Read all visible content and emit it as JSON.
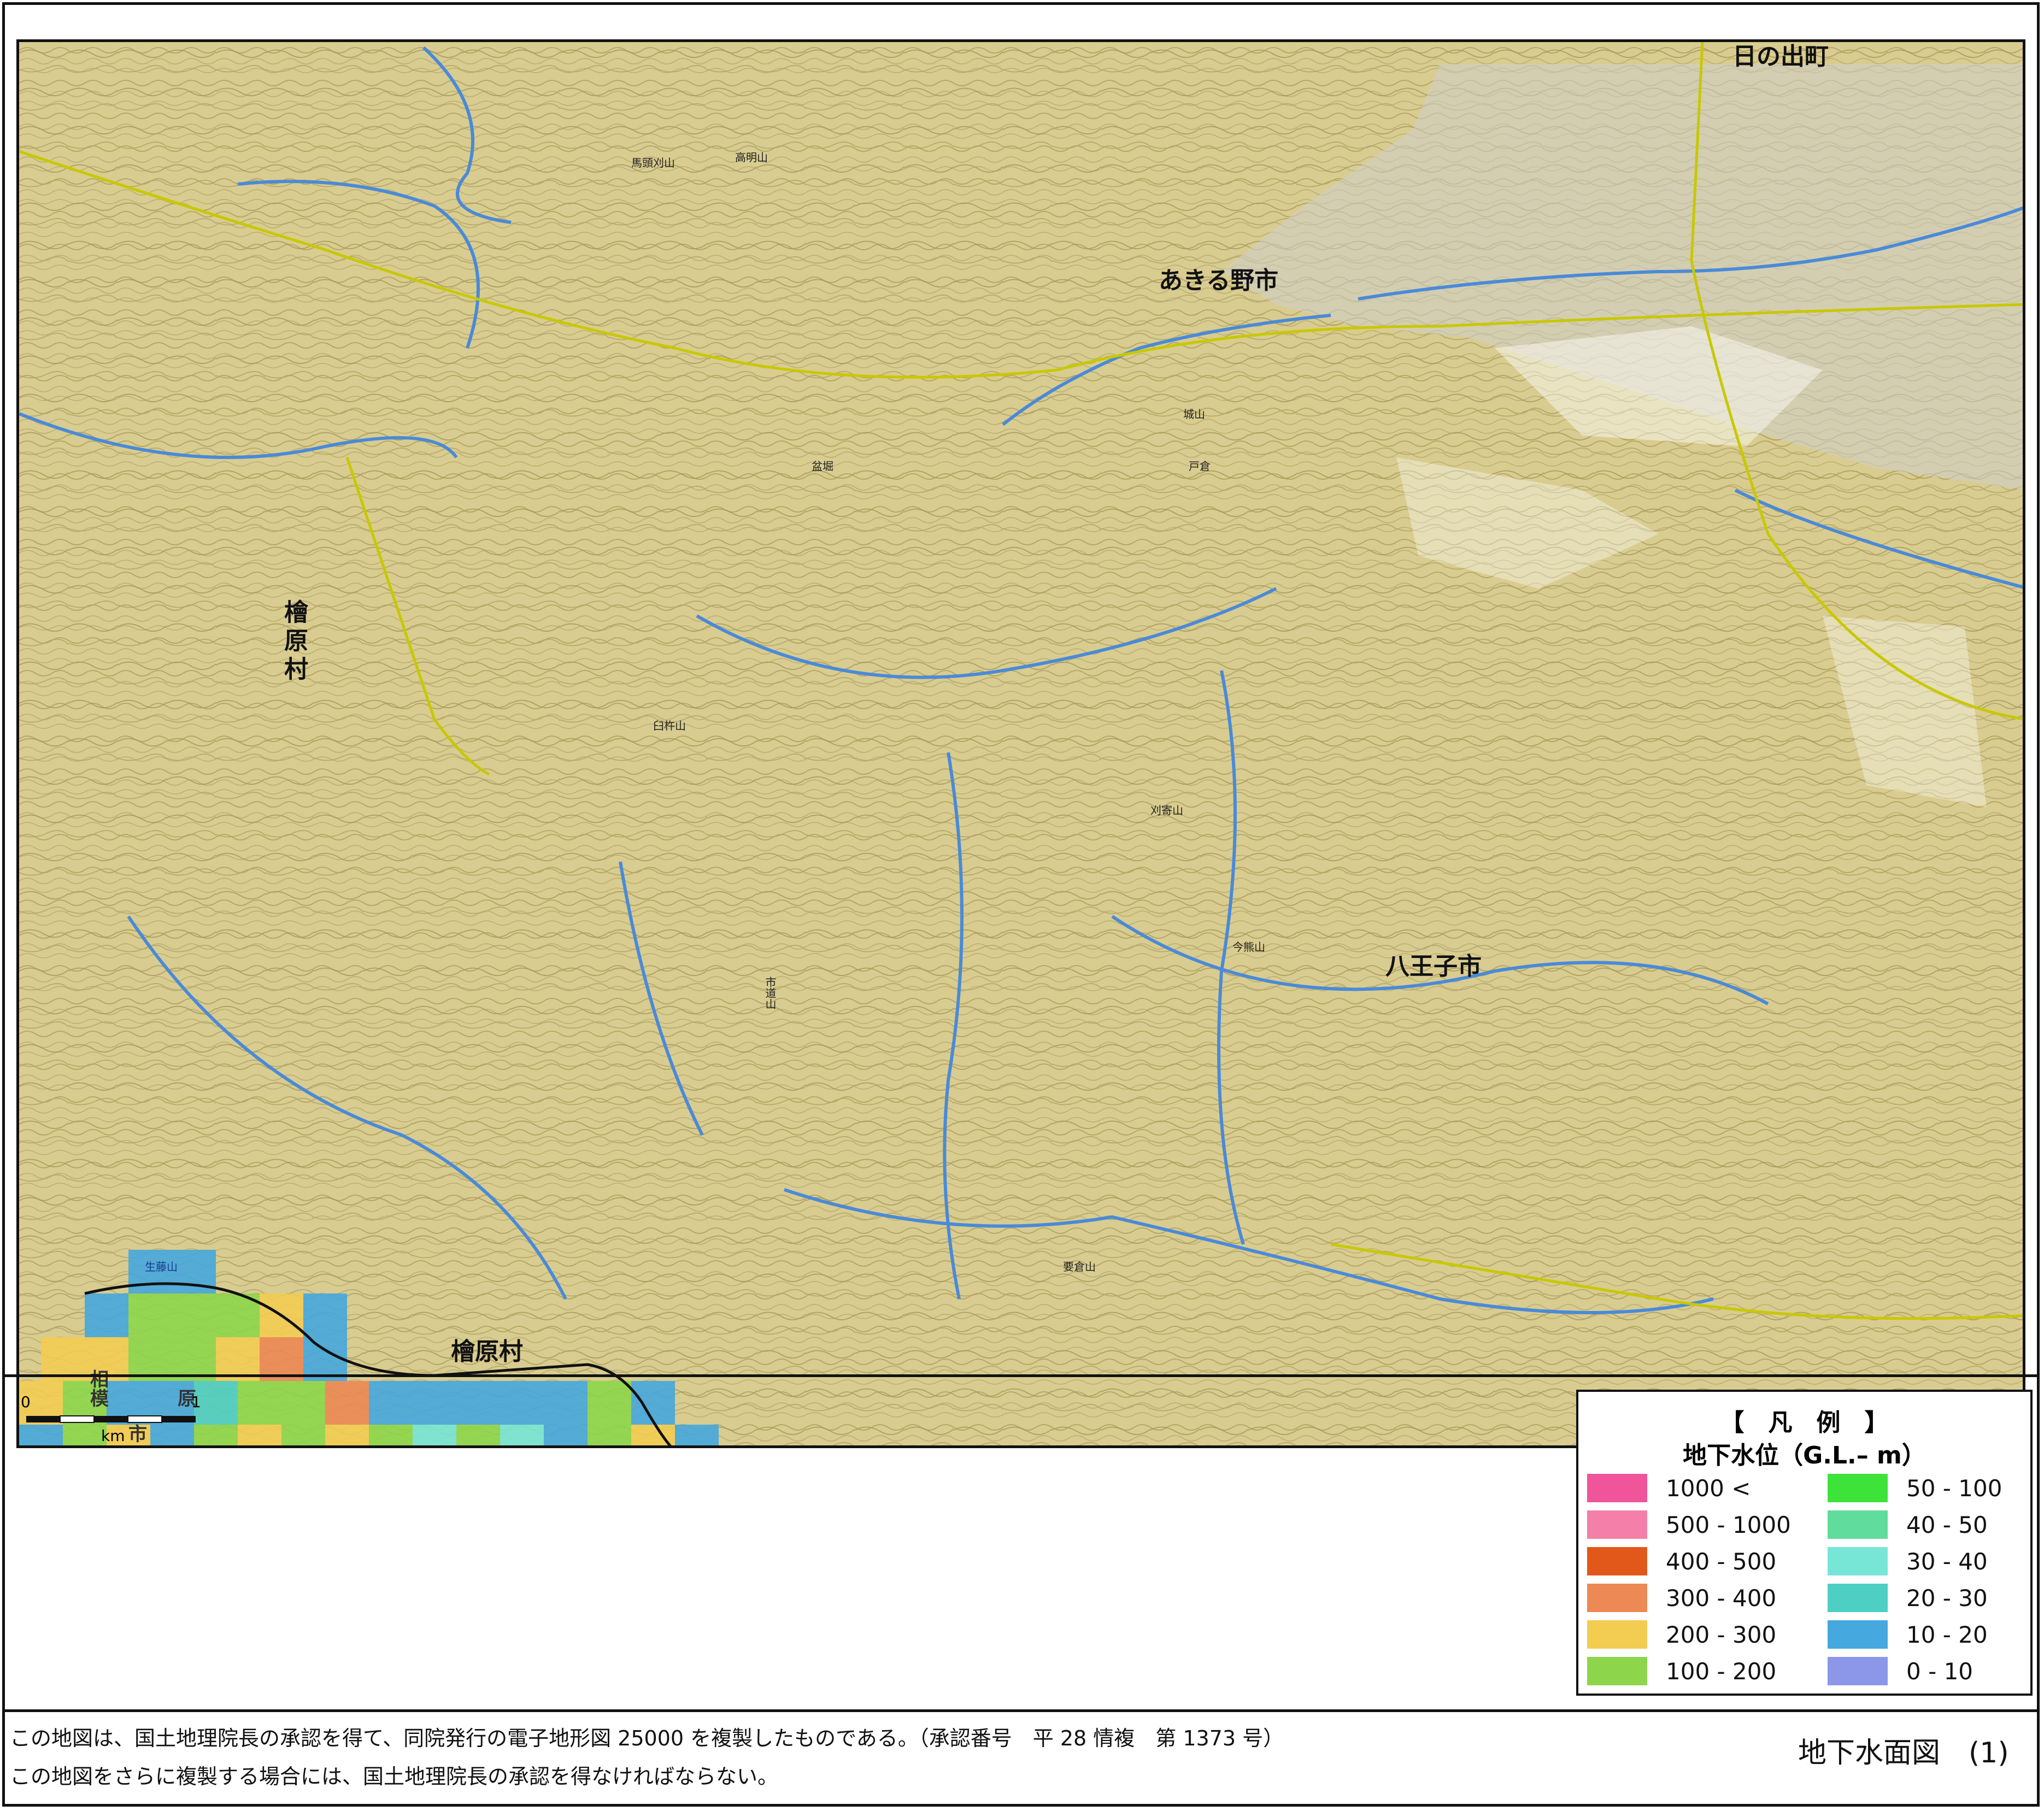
{
  "map": {
    "places": {
      "hinode": "日の出町",
      "akiruno": "あきる野市",
      "hinohara": "檜原村",
      "hinohara_south": "檜原村",
      "hachioji": "八王子市",
      "sagamihara_1": "相",
      "sagamihara_2": "模",
      "sagamihara_3": "原",
      "sagamihara_4": "市"
    },
    "mountains": [
      "馬頭刈山",
      "高明山",
      "城山",
      "臼杵山",
      "刈寄山",
      "今熊山",
      "市道山",
      "要倉山",
      "戸倉",
      "盆堀",
      "生藤山"
    ],
    "scale": {
      "start": "0",
      "end": "1",
      "unit": "km"
    }
  },
  "legend": {
    "title": "【　凡　例　】",
    "subtitle": "地下水位（G.L.– m）",
    "items": [
      {
        "label": "1000 <",
        "color": "#f0549a"
      },
      {
        "label": "500 - 1000",
        "color": "#f47fa8"
      },
      {
        "label": "400 - 500",
        "color": "#e2581a"
      },
      {
        "label": "300 - 400",
        "color": "#ec8955"
      },
      {
        "label": "200 - 300",
        "color": "#f3cd52"
      },
      {
        "label": "100 - 200",
        "color": "#8dd64c"
      },
      {
        "label": "50 - 100",
        "color": "#3ee33a"
      },
      {
        "label": "40 - 50",
        "color": "#60dc9c"
      },
      {
        "label": "30 - 40",
        "color": "#77e6d6"
      },
      {
        "label": "20 - 30",
        "color": "#4dcfc3"
      },
      {
        "label": "10 - 20",
        "color": "#45a8de"
      },
      {
        "label": "0 - 10",
        "color": "#8c97ea"
      }
    ]
  },
  "footer": {
    "line1": "この地図は、国土地理院長の承認を得て、同院発行の電子地形図 25000 を複製したものである。（承認番号　平 28 情複　第 1373 号）",
    "line2": "この地図をさらに複製する場合には、国土地理院長の承認を得なければならない。",
    "figure_title": "地下水面図　(1)"
  },
  "colors": {
    "terrain": "#d6c98c",
    "river": "#4a8ad8",
    "road": "#d4d600",
    "urban": "#c8cbd2"
  }
}
